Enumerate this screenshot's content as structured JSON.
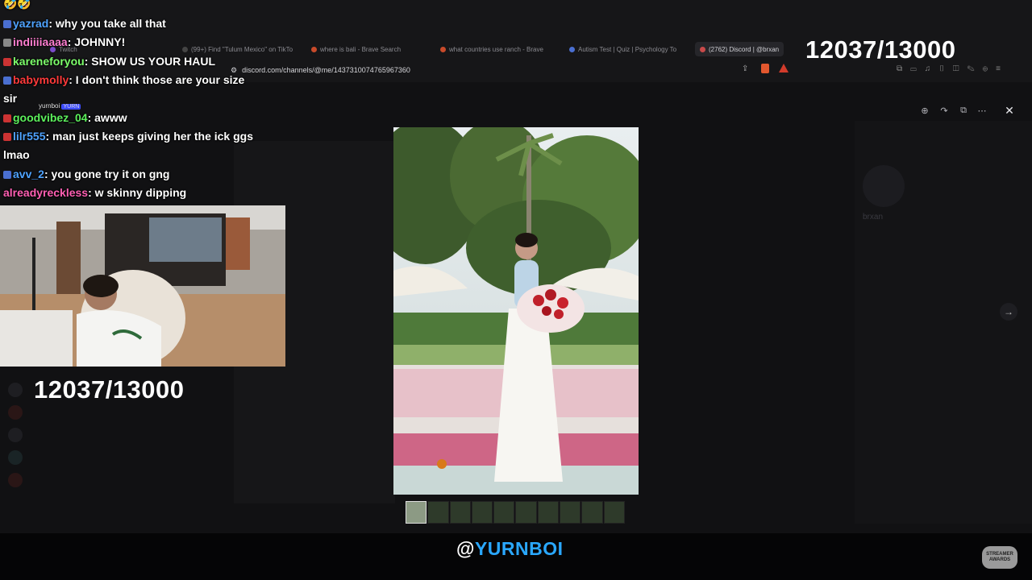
{
  "browser": {
    "tabs": [
      {
        "label": "Twitch"
      },
      {
        "label": "(99+) Find \"Tulum Mexico\" on TikTo"
      },
      {
        "label": "where is bali - Brave Search"
      },
      {
        "label": "what countries use ranch - Brave"
      },
      {
        "label": "Autism Test | Quiz | Psychology To"
      },
      {
        "label": "(2762) Discord | @brxan",
        "active": true
      }
    ],
    "url": "discord.com/channels/@me/1437310074765967360"
  },
  "overlay": {
    "counter": "12037/13000",
    "handle_at": "@",
    "handle_name": "YURNBOI",
    "logo_text": "STREAMER AWARDS"
  },
  "webcam": {
    "label": "yurnboi",
    "badge": "YURN"
  },
  "chat": [
    {
      "user": "",
      "message": "🤣🤣",
      "color": "#ffffff"
    },
    {
      "user": "yazrad",
      "message": ": why you take all that",
      "color": "#4fa3ff"
    },
    {
      "user": "indiiiiaaaa",
      "message": ": JOHNNY!",
      "color": "#ff7fd1"
    },
    {
      "user": "kareneforyou",
      "message": ": SHOW US YOUR HAUL",
      "color": "#7dff6b"
    },
    {
      "user": "babymolly",
      "message": ": I don't think those are your size",
      "color": "#ff3a3a"
    },
    {
      "user": "",
      "message": "sir",
      "color": "#ffffff"
    },
    {
      "user": "goodvibez_04",
      "message": ": awww",
      "color": "#5cf05c"
    },
    {
      "user": "lilr555",
      "message": ": man just keeps giving her the ick ggs",
      "color": "#4fa3ff"
    },
    {
      "user": "",
      "message": "lmao",
      "color": "#ffffff"
    },
    {
      "user": "avv_2",
      "message": ": you gone try it on gng",
      "color": "#4fa3ff"
    },
    {
      "user": "alreadyreckless",
      "message": ": w skinny dipping",
      "color": "#ff5fb3"
    }
  ],
  "discord": {
    "profile_name": "brxan"
  },
  "icons": [
    "zoom-in-icon",
    "rotate-icon",
    "open-external-icon",
    "more-icon",
    "close-icon",
    "next-arrow-icon"
  ]
}
